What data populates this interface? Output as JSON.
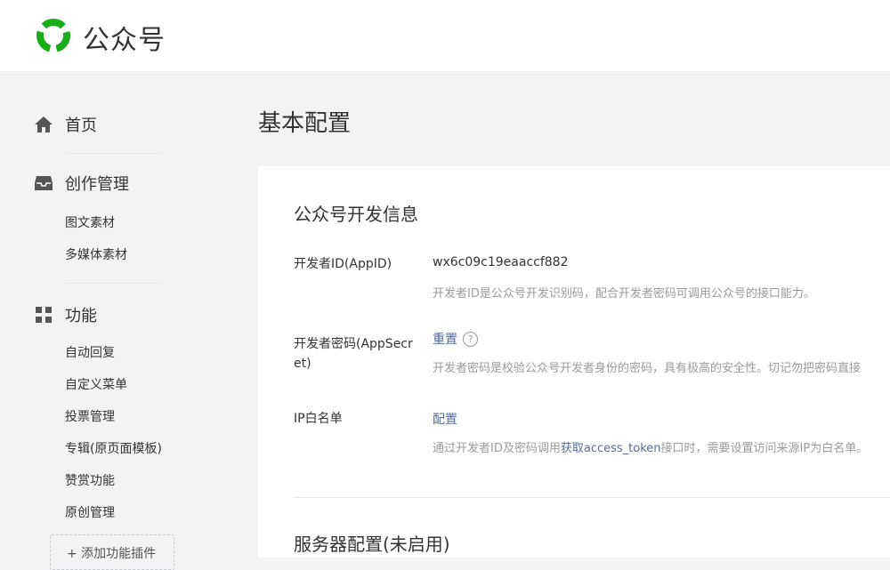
{
  "header": {
    "brand": "公众号"
  },
  "sidebar": {
    "groups": [
      {
        "label": "首页",
        "icon": "home-icon",
        "items": []
      },
      {
        "label": "创作管理",
        "icon": "inbox-icon",
        "items": [
          "图文素材",
          "多媒体素材"
        ]
      },
      {
        "label": "功能",
        "icon": "grid-icon",
        "items": [
          "自动回复",
          "自定义菜单",
          "投票管理",
          "专辑(原页面模板)",
          "赞赏功能",
          "原创管理"
        ]
      }
    ],
    "add_plugin": "+ 添加功能插件"
  },
  "main": {
    "page_title": "基本配置",
    "dev_info": {
      "title": "公众号开发信息",
      "appid_label": "开发者ID(AppID)",
      "appid_value": "wx6c09c19eaaccf882",
      "appid_desc": "开发者ID是公众号开发识别码，配合开发者密码可调用公众号的接口能力。",
      "secret_label": "开发者密码(AppSecret)",
      "secret_action": "重置",
      "secret_desc": "开发者密码是校验公众号开发者身份的密码，具有极高的安全性。切记勿把密码直接",
      "ip_label": "IP白名单",
      "ip_action": "配置",
      "ip_desc_pre": "通过开发者ID及密码调用",
      "ip_desc_link": "获取access_token",
      "ip_desc_post": "接口时，需要设置访问来源IP为白名单。"
    },
    "server_config": {
      "title": "服务器配置(未启用)"
    }
  },
  "colors": {
    "brand_green": "#1aad19",
    "link": "#576b95"
  }
}
